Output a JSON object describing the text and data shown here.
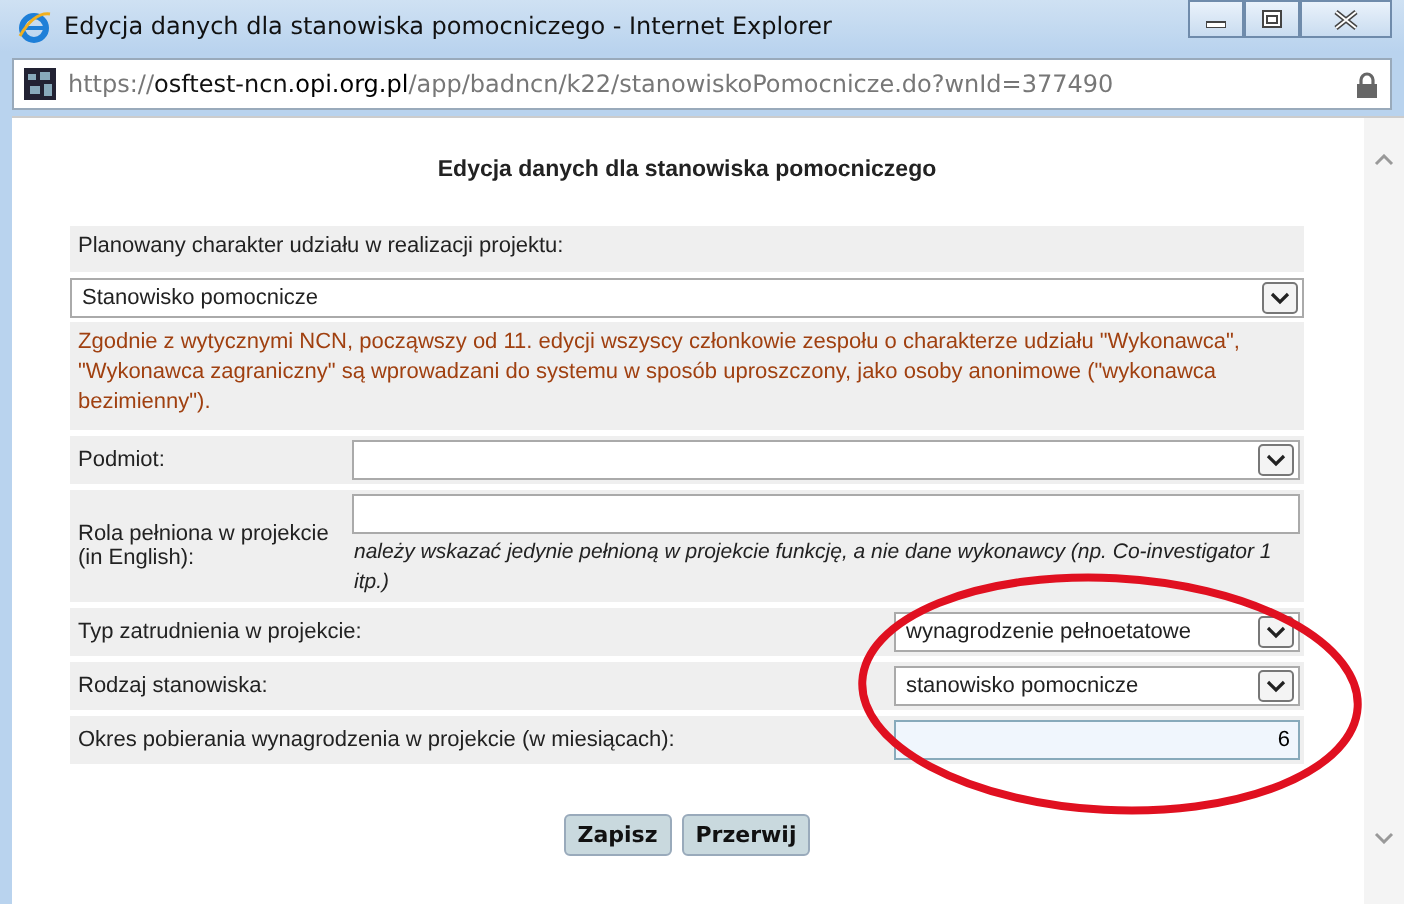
{
  "window": {
    "title": "Edycja danych dla stanowiska pomocniczego - Internet Explorer"
  },
  "address_bar": {
    "scheme": "https://",
    "host_prefix": "osftest-ncn.",
    "host_domain": "opi.org.pl",
    "path": "/app/badncn/k22/stanowiskoPomocnicze.do?wnId=377490"
  },
  "form": {
    "heading": "Edycja danych dla stanowiska pomocniczego",
    "participation": {
      "label": "Planowany charakter udziału w realizacji projektu:",
      "value": "Stanowisko pomocnicze",
      "note": "Zgodnie z wytycznymi NCN, począwszy od 11. edycji wszyscy członkowie zespołu o charakterze udziału \"Wykonawca\", \"Wykonawca zagraniczny\" są wprowadzani do systemu w sposób uproszczony, jako osoby anonimowe (\"wykonawca bezimienny\")."
    },
    "fields": [
      {
        "kind": "select",
        "label": "Podmiot:",
        "wide": true
      },
      {
        "kind": "text",
        "label": "Rola pełniona w projekcie (in English):",
        "wide": true,
        "hint": "należy wskazać jedynie pełnioną w projekcie funkcję, a nie dane wykonawcy (np. Co-investigator 1 itp.)"
      },
      {
        "kind": "select",
        "label": "Typ zatrudnienia w projekcie:",
        "wide": false,
        "value": "wynagrodzenie pełnoetatowe"
      },
      {
        "kind": "select",
        "label": "Rodzaj stanowiska:",
        "wide": false,
        "value": "stanowisko pomocnicze"
      },
      {
        "kind": "number",
        "label": "Okres pobierania wynagrodzenia w projekcie (w miesiącach):",
        "wide": false,
        "value": "6",
        "focused": true
      }
    ],
    "buttons": [
      "Zapisz",
      "Przerwij"
    ]
  },
  "annotation": {
    "kind": "ellipse",
    "color": "#e01020"
  }
}
